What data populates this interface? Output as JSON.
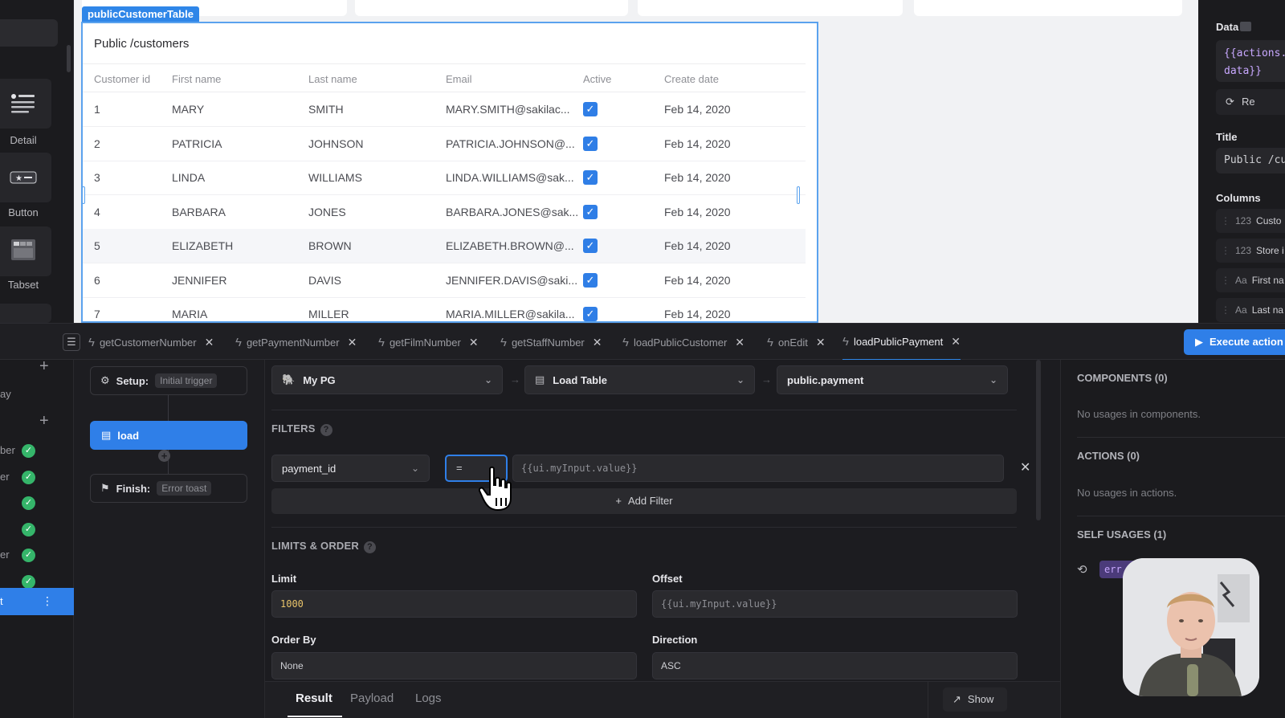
{
  "palette": {
    "items": [
      {
        "label": "Detail",
        "icon": "detail-icon"
      },
      {
        "label": "Button",
        "icon": "button-icon"
      },
      {
        "label": "Tabset",
        "icon": "tabset-icon"
      }
    ]
  },
  "canvas": {
    "component_tag": "publicCustomerTable",
    "table": {
      "title": "Public /customers",
      "columns": [
        "Customer id",
        "First name",
        "Last name",
        "Email",
        "Active",
        "Create date"
      ],
      "rows": [
        {
          "id": "1",
          "first": "MARY",
          "last": "SMITH",
          "email": "MARY.SMITH@sakilac...",
          "active": true,
          "date": "Feb 14, 2020"
        },
        {
          "id": "2",
          "first": "PATRICIA",
          "last": "JOHNSON",
          "email": "PATRICIA.JOHNSON@...",
          "active": true,
          "date": "Feb 14, 2020"
        },
        {
          "id": "3",
          "first": "LINDA",
          "last": "WILLIAMS",
          "email": "LINDA.WILLIAMS@sak...",
          "active": true,
          "date": "Feb 14, 2020"
        },
        {
          "id": "4",
          "first": "BARBARA",
          "last": "JONES",
          "email": "BARBARA.JONES@sak...",
          "active": true,
          "date": "Feb 14, 2020"
        },
        {
          "id": "5",
          "first": "ELIZABETH",
          "last": "BROWN",
          "email": "ELIZABETH.BROWN@...",
          "active": true,
          "date": "Feb 14, 2020"
        },
        {
          "id": "6",
          "first": "JENNIFER",
          "last": "DAVIS",
          "email": "JENNIFER.DAVIS@saki...",
          "active": true,
          "date": "Feb 14, 2020"
        },
        {
          "id": "7",
          "first": "MARIA",
          "last": "MILLER",
          "email": "MARIA.MILLER@sakila...",
          "active": true,
          "date": "Feb 14, 2020"
        }
      ]
    }
  },
  "inspector": {
    "data_label": "Data",
    "data_value_line1": "{{actions.",
    "data_value_line2": "data}}",
    "refresh_label": "Re",
    "title_label": "Title",
    "title_value": "Public /cu",
    "columns_label": "Columns",
    "columns": [
      {
        "type": "123",
        "name": "Custo"
      },
      {
        "type": "123",
        "name": "Store i"
      },
      {
        "type": "Aa",
        "name": "First na"
      },
      {
        "type": "Aa",
        "name": "Last na"
      }
    ]
  },
  "tabs": [
    {
      "label": "getCustomerNumber"
    },
    {
      "label": "getPaymentNumber"
    },
    {
      "label": "getFilmNumber"
    },
    {
      "label": "getStaffNumber"
    },
    {
      "label": "loadPublicCustomer"
    },
    {
      "label": "onEdit"
    },
    {
      "label": "loadPublicPayment"
    }
  ],
  "execute_button": "Execute action",
  "actions_list": {
    "items": [
      "ay",
      "ber",
      "er",
      "",
      "",
      "er",
      ""
    ],
    "selected_label": "t"
  },
  "flow": {
    "setup_label": "Setup:",
    "setup_chip": "Initial trigger",
    "load_label": "load",
    "finish_label": "Finish:",
    "finish_chip": "Error toast"
  },
  "editor": {
    "datasource": "My PG",
    "operation": "Load Table",
    "table": "public.payment",
    "filters_label": "FILTERS",
    "filter_field": "payment_id",
    "filter_op": "=",
    "filter_value": "{{ui.myInput.value}}",
    "add_filter": "Add Filter",
    "limits_label": "LIMITS & ORDER",
    "limit_label": "Limit",
    "limit_value": "1000",
    "offset_label": "Offset",
    "offset_value": "{{ui.myInput.value}}",
    "orderby_label": "Order By",
    "orderby_value": "None",
    "direction_label": "Direction",
    "direction_value": "ASC"
  },
  "result_tabs": [
    "Result",
    "Payload",
    "Logs"
  ],
  "show_button": "Show",
  "usages": {
    "components_title": "COMPONENTS (0)",
    "components_text": "No usages in components.",
    "actions_title": "ACTIONS (0)",
    "actions_text": "No usages in actions.",
    "self_title": "SELF USAGES (1)",
    "self_chip": "err"
  },
  "colors": {
    "accent": "#2f7fe8",
    "success": "#35b56a",
    "panel_bg": "#1c1c20",
    "canvas_bg": "#f1f2f4"
  }
}
